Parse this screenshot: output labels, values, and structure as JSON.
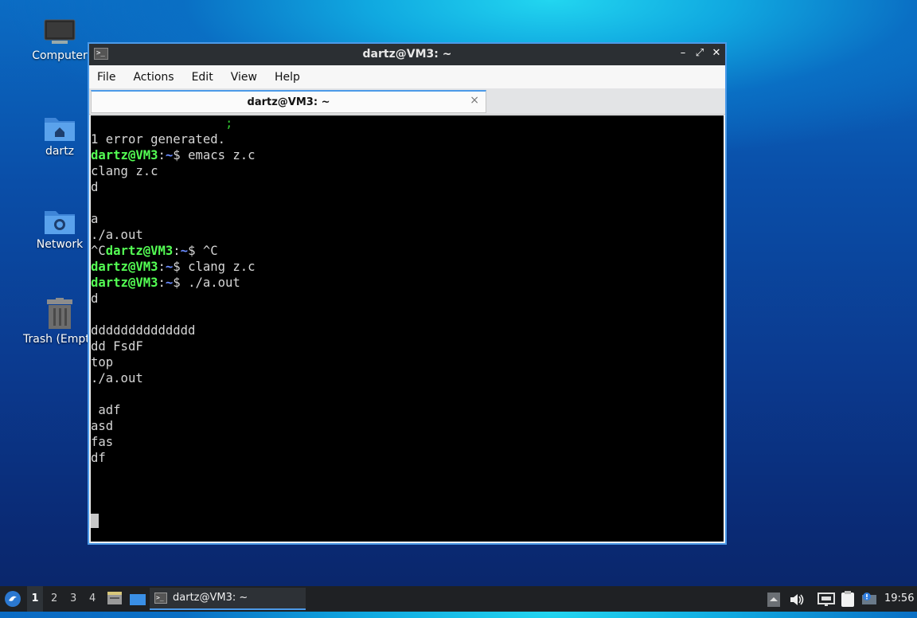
{
  "desktop": {
    "icons": [
      {
        "name": "computer",
        "label": "Computer",
        "icon": "monitor-icon"
      },
      {
        "name": "home",
        "label": "dartz",
        "icon": "home-folder-icon"
      },
      {
        "name": "network",
        "label": "Network",
        "icon": "network-folder-icon"
      },
      {
        "name": "trash",
        "label": "Trash (Empty)",
        "icon": "trash-icon"
      }
    ]
  },
  "window": {
    "title": "dartz@VM3: ~",
    "menu": [
      "File",
      "Actions",
      "Edit",
      "View",
      "Help"
    ],
    "tab": {
      "label": "dartz@VM3: ~",
      "close": "×"
    },
    "controls": {
      "minimize": "–",
      "maximize": "⤢",
      "close": "✕"
    },
    "term_icon": ">_"
  },
  "terminal": {
    "prompt_user": "dartz@VM3",
    "prompt_colon": ":",
    "prompt_tilde": "~",
    "prompt_dollar": "$ ",
    "partial_semicolon": "                  ;",
    "line_error": "1 error generated.",
    "cmd_emacs": "emacs z.c",
    "out_clang": "clang z.c",
    "out_d1": "d",
    "out_a": "a",
    "out_aout1": "./a.out",
    "ctrl_c_prefix": "^C",
    "cmd_ctrl_c": "^C",
    "cmd_clang": "clang z.c",
    "cmd_aout": "./a.out",
    "out_d2": "d",
    "out_ddd": "dddddddddddddd",
    "out_dd": "dd FsdF",
    "out_top": "top",
    "out_aout2": "./a.out",
    "out_adf": " adf",
    "out_asd": "asd",
    "out_fas": "fas",
    "out_df": "df"
  },
  "taskbar": {
    "workspaces": [
      "1",
      "2",
      "3",
      "4"
    ],
    "task_label": "dartz@VM3: ~",
    "clock": "19:56",
    "icons": [
      "start-menu-icon",
      "file-manager-icon",
      "show-desktop-icon",
      "terminal-icon",
      "scroll-up-icon",
      "volume-icon",
      "network-icon",
      "clipboard-icon",
      "notification-icon"
    ]
  }
}
